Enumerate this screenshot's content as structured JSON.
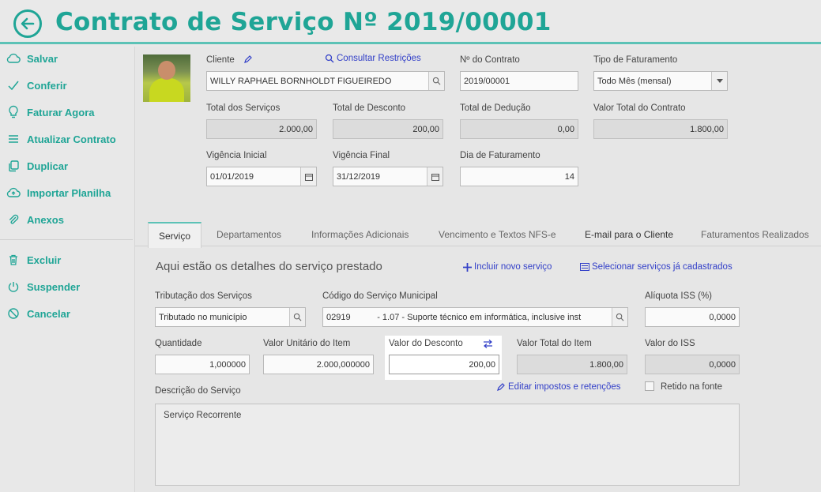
{
  "header": {
    "title": "Contrato de Serviço Nº 2019/00001"
  },
  "sidebar": {
    "items": [
      {
        "label": "Salvar",
        "icon": "cloud-icon"
      },
      {
        "label": "Conferir",
        "icon": "check-icon"
      },
      {
        "label": "Faturar Agora",
        "icon": "lightbulb-icon"
      },
      {
        "label": "Atualizar Contrato",
        "icon": "list-icon"
      },
      {
        "label": "Duplicar",
        "icon": "copy-icon"
      },
      {
        "label": "Importar Planilha",
        "icon": "cloud-upload-icon"
      },
      {
        "label": "Anexos",
        "icon": "paperclip-icon"
      },
      {
        "label": "Excluir",
        "icon": "trash-icon"
      },
      {
        "label": "Suspender",
        "icon": "power-icon"
      },
      {
        "label": "Cancelar",
        "icon": "ban-icon"
      }
    ]
  },
  "contract": {
    "cliente_label": "Cliente",
    "cliente_value": "WILLY RAPHAEL BORNHOLDT FIGUEIREDO",
    "consultar_label": "Consultar Restrições",
    "numero_label": "Nº do Contrato",
    "numero_value": "2019/00001",
    "tipo_label": "Tipo de Faturamento",
    "tipo_value": "Todo Mês (mensal)",
    "total_servicos_label": "Total dos Serviços",
    "total_servicos_value": "2.000,00",
    "total_desconto_label": "Total de Desconto",
    "total_desconto_value": "200,00",
    "total_deducao_label": "Total de Dedução",
    "total_deducao_value": "0,00",
    "valor_total_label": "Valor Total do Contrato",
    "valor_total_value": "1.800,00",
    "vig_inicial_label": "Vigência Inicial",
    "vig_inicial_value": "01/01/2019",
    "vig_final_label": "Vigência Final",
    "vig_final_value": "31/12/2019",
    "dia_label": "Dia de Faturamento",
    "dia_value": "14"
  },
  "tabs": [
    {
      "label": "Serviço"
    },
    {
      "label": "Departamentos"
    },
    {
      "label": "Informações Adicionais"
    },
    {
      "label": "Vencimento e Textos NFS-e"
    },
    {
      "label": "E-mail para o Cliente"
    },
    {
      "label": "Faturamentos Realizados"
    }
  ],
  "service": {
    "section_title": "Aqui estão os detalhes do serviço prestado",
    "incluir_label": "Incluir novo serviço",
    "selecionar_label": "Selecionar serviços já cadastrados",
    "tributacao_label": "Tributação dos Serviços",
    "tributacao_value": "Tributado no município",
    "codigo_label": "Código do Serviço Municipal",
    "codigo_value": "02919           - 1.07 - Suporte técnico em informática, inclusive inst",
    "aliquota_label": "Alíquota ISS (%)",
    "aliquota_value": "0,0000",
    "quantidade_label": "Quantidade",
    "quantidade_value": "1,000000",
    "valor_unitario_label": "Valor Unitário do Item",
    "valor_unitario_value": "2.000,000000",
    "valor_desconto_label": "Valor do Desconto",
    "valor_desconto_value": "200,00",
    "valor_total_item_label": "Valor Total do Item",
    "valor_total_item_value": "1.800,00",
    "valor_iss_label": "Valor do ISS",
    "valor_iss_value": "0,0000",
    "editar_impostos_label": "Editar impostos e retenções",
    "retido_label": "Retido na fonte",
    "descricao_label": "Descrição do Serviço",
    "descricao_value": "Serviço Recorrente"
  },
  "colors": {
    "accent": "#1fa596",
    "link": "#3340c8"
  }
}
